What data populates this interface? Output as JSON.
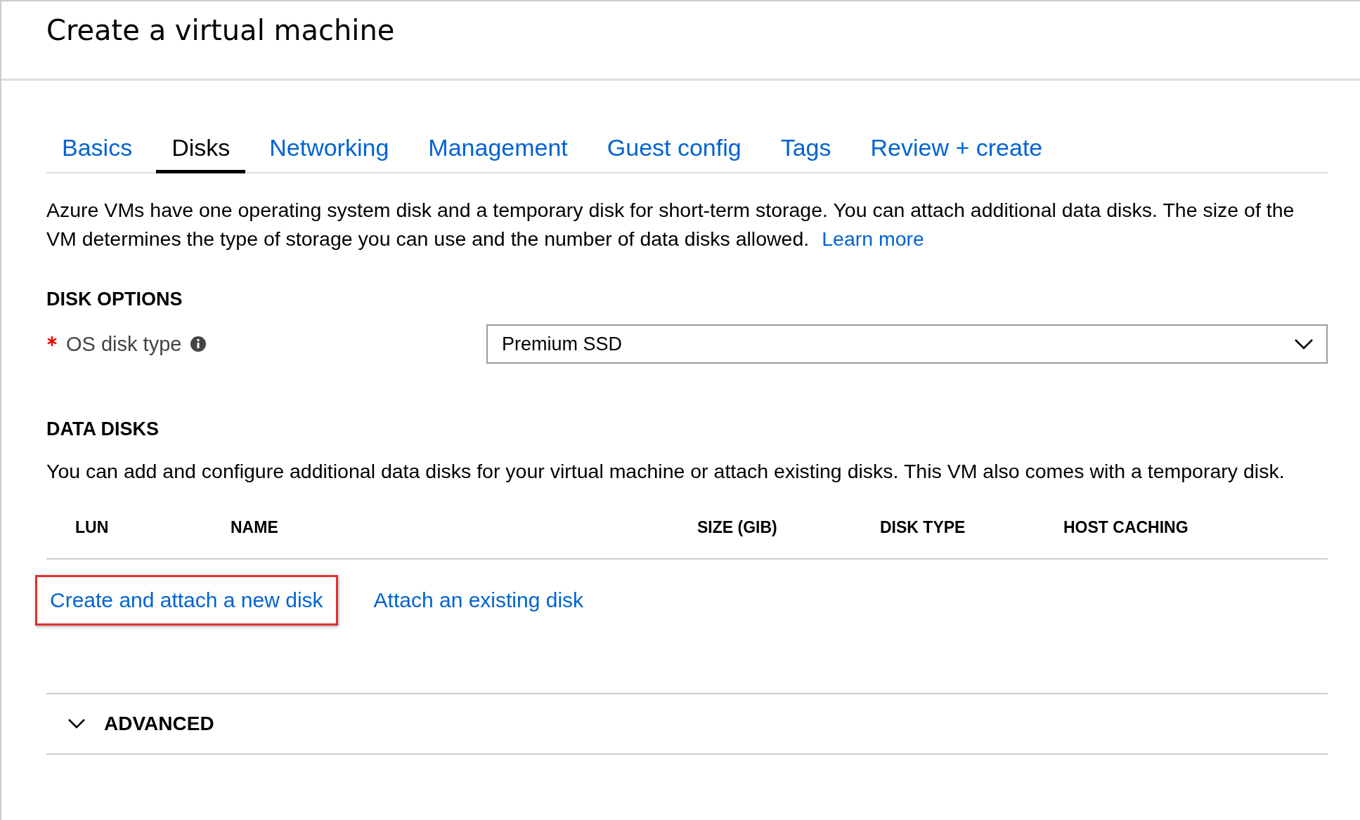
{
  "header": {
    "title": "Create a virtual machine"
  },
  "tabs": [
    {
      "label": "Basics",
      "selected": false
    },
    {
      "label": "Disks",
      "selected": true
    },
    {
      "label": "Networking",
      "selected": false
    },
    {
      "label": "Management",
      "selected": false
    },
    {
      "label": "Guest config",
      "selected": false
    },
    {
      "label": "Tags",
      "selected": false
    },
    {
      "label": "Review + create",
      "selected": false
    }
  ],
  "intro": {
    "text": "Azure VMs have one operating system disk and a temporary disk for short-term storage. You can attach additional data disks. The size of the VM determines the type of storage you can use and the number of data disks allowed.",
    "link": "Learn more"
  },
  "disk_options": {
    "heading": "DISK OPTIONS",
    "field": {
      "label": "OS disk type",
      "required": true,
      "value": "Premium SSD"
    }
  },
  "data_disks": {
    "heading": "DATA DISKS",
    "text": "You can add and configure additional data disks for your virtual machine or attach existing disks. This VM also comes with a temporary disk.",
    "columns": [
      "LUN",
      "NAME",
      "SIZE (GIB)",
      "DISK TYPE",
      "HOST CACHING"
    ],
    "actions": [
      {
        "label": "Create and attach a new disk",
        "highlighted": true
      },
      {
        "label": "Attach an existing disk",
        "highlighted": false
      }
    ]
  },
  "advanced": {
    "label": "ADVANCED",
    "expanded": false
  }
}
